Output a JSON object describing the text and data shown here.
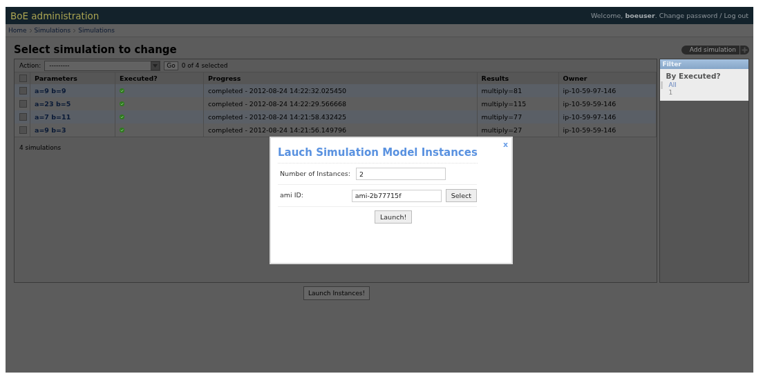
{
  "header": {
    "title": "BoE administration",
    "welcome": "Welcome, **boeuser**.",
    "links": [
      "Change password",
      "Log out"
    ],
    "separator": "/"
  },
  "breadcrumbs": [
    "Home",
    "Simulations",
    "Simulations"
  ],
  "page_title": "Select simulation to change",
  "add_button": "Add simulation",
  "actions": {
    "label": "Action:",
    "value": "---------",
    "go": "Go",
    "selected_count": "0 of 4 selected"
  },
  "table": {
    "select_all_checked": false,
    "columns": [
      "Parameters",
      "Executed?",
      "Progress",
      "Results",
      "Owner"
    ],
    "rows": [
      {
        "checked": false,
        "parameters": "a=9 b=9",
        "executed": true,
        "progress": "completed - 2012-08-24 14:22:32.025450",
        "results": "multiply=81",
        "owner": "ip-10-59-97-146"
      },
      {
        "checked": false,
        "parameters": "a=23 b=5",
        "executed": true,
        "progress": "completed - 2012-08-24 14:22:29.566668",
        "results": "multiply=115",
        "owner": "ip-10-59-59-146"
      },
      {
        "checked": false,
        "parameters": "a=7 b=11",
        "executed": true,
        "progress": "completed - 2012-08-24 14:21:58.432425",
        "results": "multiply=77",
        "owner": "ip-10-59-97-146"
      },
      {
        "checked": false,
        "parameters": "a=9 b=3",
        "executed": true,
        "progress": "completed - 2012-08-24 14:21:56.149796",
        "results": "multiply=27",
        "owner": "ip-10-59-59-146"
      }
    ],
    "footer": "4 simulations"
  },
  "filter": {
    "title": "Filter",
    "heading": "By Executed?",
    "options": [
      {
        "label": "All",
        "selected": true
      },
      {
        "label": "1",
        "selected": false
      }
    ]
  },
  "launch_instances": "Launch Instances!",
  "dialog": {
    "title": "Lauch Simulation Model Instances",
    "close": "x",
    "fields": [
      {
        "label": "Number of Instances:",
        "value": "2"
      },
      {
        "label": "ami ID:",
        "value": "ami-2b77715f",
        "button": "Select"
      }
    ],
    "submit": "Launch!"
  }
}
